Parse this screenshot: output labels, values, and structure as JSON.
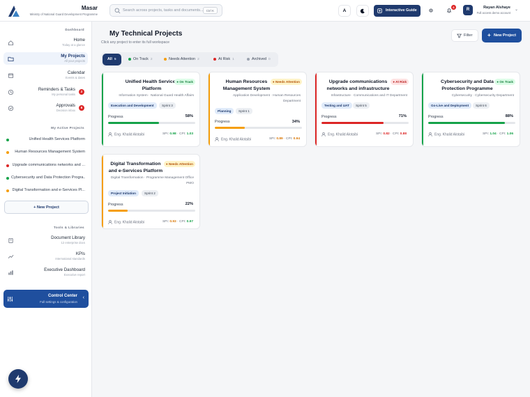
{
  "brand": {
    "name": "Masar",
    "subtitle": "Ministry of National Guard Development Programme"
  },
  "search": {
    "placeholder": "Search across projects, tasks and documents...",
    "shortcut": "Ctrl K"
  },
  "topbar": {
    "lang_label": "A",
    "guide_label": "Interactive Guide",
    "notif_count": "6"
  },
  "user": {
    "initial": "R",
    "name": "Rayan Alshaye",
    "role": "Full access demo account"
  },
  "sidebar": {
    "section_dashboard": "Dashboard",
    "nav": [
      {
        "label": "Home",
        "sub": "Today at a glance"
      },
      {
        "label": "My Projects",
        "sub": "All your projects"
      },
      {
        "label": "Calendar",
        "sub": "Events & dates"
      },
      {
        "label": "Reminders & Tasks",
        "sub": "My personal tasks",
        "badge": "2"
      },
      {
        "label": "Approvals",
        "sub": "Decision inbox",
        "badge": "6"
      }
    ],
    "section_active": "My Active Projects",
    "projects": [
      {
        "label": "Unified Health Services Platform",
        "color": "#16a34a"
      },
      {
        "label": "Human Resources Management System",
        "color": "#f59e0b"
      },
      {
        "label": "Upgrade communications networks and ...",
        "color": "#dc2626"
      },
      {
        "label": "Cybersecurity and Data Protection Progra...",
        "color": "#16a34a"
      },
      {
        "label": "Digital Transformation and e-Services Pl...",
        "color": "#f59e0b"
      }
    ],
    "new_project": "New Project",
    "section_tools": "Tools & Libraries",
    "tools": [
      {
        "label": "Document Library",
        "sub": "12 enterprise docs"
      },
      {
        "label": "KPIs",
        "sub": "International standards"
      },
      {
        "label": "Executive Dashboard",
        "sub": "Executive report"
      }
    ],
    "control_center": {
      "label": "Control Center",
      "sub": "Full settings & configuration"
    }
  },
  "main": {
    "title": "My Technical Projects",
    "subtitle": "Click any project to enter its full workspace",
    "filter_label": "Filter",
    "new_project_label": "New Project",
    "tabs": [
      {
        "label": "All",
        "count": "5",
        "color": ""
      },
      {
        "label": "On Track",
        "count": "2",
        "color": "#16a34a"
      },
      {
        "label": "Needs Attention",
        "count": "2",
        "color": "#f59e0b"
      },
      {
        "label": "At Risk",
        "count": "1",
        "color": "#dc2626"
      },
      {
        "label": "Archived",
        "count": "0",
        "color": "#9ca3af"
      }
    ],
    "progress_label": "Progress",
    "cards": [
      {
        "title": "Unified Health Services Platform",
        "status": "On Track",
        "status_color": "#16a34a",
        "desc": "Information System · National Guard Health Affairs",
        "phase": "Execution and Development",
        "sprint": "Sprint 3",
        "progress": "58%",
        "progress_value": 58,
        "owner": "Eng. Khalid Alotaibi",
        "spi_label": "SPI:",
        "spi": "0.98",
        "spi_cls": "ok",
        "cpi_label": "· CPI:",
        "cpi": "1.03",
        "cpi_cls": "ok"
      },
      {
        "title": "Human Resources Management System",
        "status": "Needs Attention",
        "status_color": "#f59e0b",
        "desc": "Application Development · Human Resources Department",
        "phase": "Planning",
        "sprint": "Sprint 1",
        "progress": "34%",
        "progress_value": 34,
        "owner": "Eng. Khalid Alotaibi",
        "spi_label": "SPI:",
        "spi": "0.89",
        "spi_cls": "warn",
        "cpi_label": "· CPI:",
        "cpi": "0.94",
        "cpi_cls": "warn"
      },
      {
        "title": "Upgrade communications networks and infrastructure",
        "status": "At Risk",
        "status_color": "#dc2626",
        "desc": "Infrastructure · Communications and IT Department",
        "phase": "Testing and UAT",
        "sprint": "Sprint 5",
        "progress": "71%",
        "progress_value": 71,
        "owner": "Eng. Khalid Alotaibi",
        "spi_label": "SPI:",
        "spi": "0.82",
        "spi_cls": "bad",
        "cpi_label": "· CPI:",
        "cpi": "0.88",
        "cpi_cls": "bad"
      },
      {
        "title": "Cybersecurity and Data Protection Programme",
        "status": "On Track",
        "status_color": "#16a34a",
        "desc": "Cybersecurity · Cybersecurity Department",
        "phase": "Go-Live and Deployment",
        "sprint": "Sprint 6",
        "progress": "88%",
        "progress_value": 88,
        "owner": "Eng. Khalid Alotaibi",
        "spi_label": "SPI:",
        "spi": "1.04",
        "spi_cls": "ok",
        "cpi_label": "· CPI:",
        "cpi": "1.06",
        "cpi_cls": "ok"
      },
      {
        "title": "Digital Transformation and e-Services Platform",
        "status": "Needs Attention",
        "status_color": "#f59e0b",
        "desc": "Digital Transformation · Programme Management Office PMO",
        "phase": "Project Initiation",
        "sprint": "Sprint 2",
        "progress": "22%",
        "progress_value": 22,
        "owner": "Eng. Khalid Alotaibi",
        "spi_label": "SPI:",
        "spi": "0.93",
        "spi_cls": "warn",
        "cpi_label": "· CPI:",
        "cpi": "0.97",
        "cpi_cls": "ok"
      }
    ]
  }
}
